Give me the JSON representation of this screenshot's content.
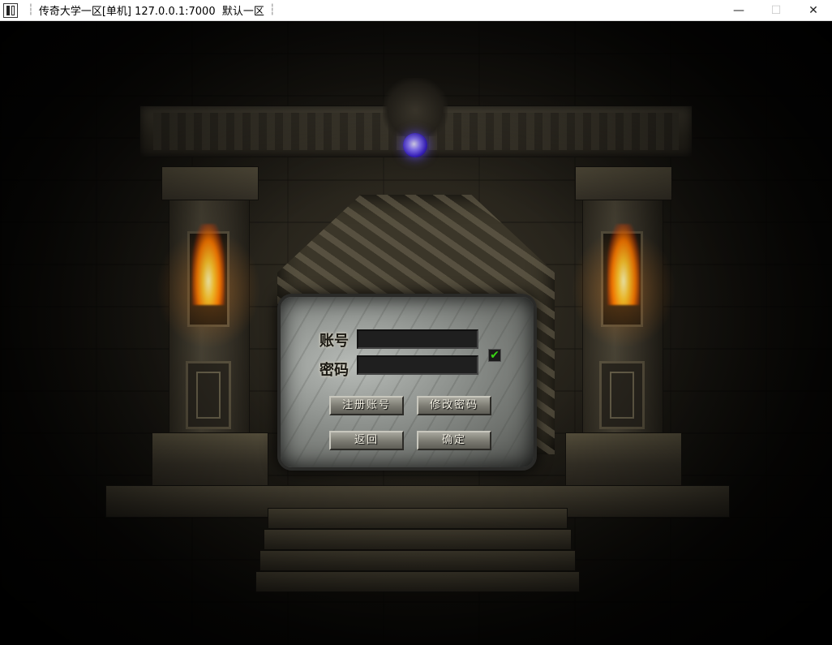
{
  "window": {
    "title": "传奇大学一区[单机] 127.0.0.1:7000  默认一区",
    "separator_glyph": "┆",
    "minimize_glyph": "—",
    "maximize_glyph": "☐",
    "close_glyph": "✕"
  },
  "login": {
    "account_label": "账号",
    "password_label": "密码",
    "account_value": "",
    "password_value": "",
    "remember_checked": true,
    "check_glyph": "✔",
    "buttons": {
      "register": "注册账号",
      "change_password": "修改密码",
      "back": "返回",
      "confirm": "确定"
    }
  },
  "colors": {
    "gem": "#6a55ff",
    "flame": "#ffa31a",
    "checkmark": "#38d414"
  }
}
